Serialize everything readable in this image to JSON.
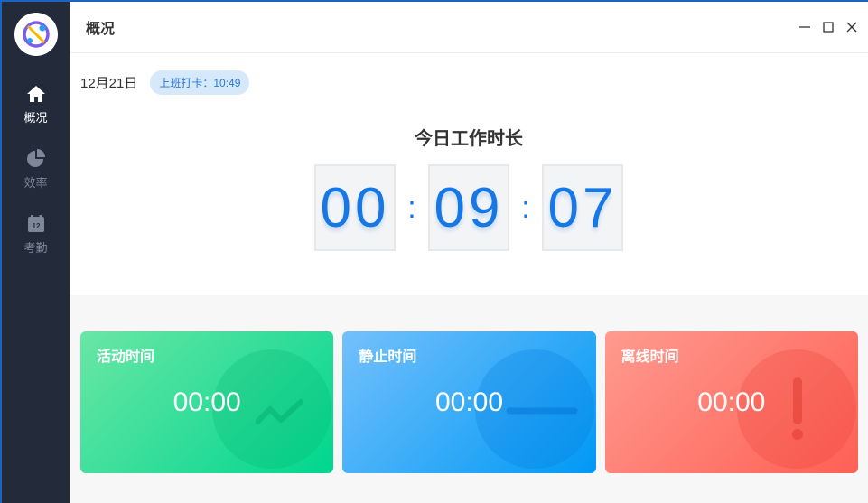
{
  "window": {
    "title": "概况"
  },
  "sidebar": {
    "items": [
      {
        "label": "概况",
        "icon": "home-icon",
        "active": true
      },
      {
        "label": "效率",
        "icon": "pie-chart-icon",
        "active": false
      },
      {
        "label": "考勤",
        "icon": "calendar-icon",
        "active": false
      }
    ]
  },
  "header": {
    "date": "12月21日",
    "checkin_badge": "上班打卡：10:49"
  },
  "work_time": {
    "title": "今日工作时长",
    "hours": "00",
    "minutes": "09",
    "seconds": "07",
    "separator": ":"
  },
  "cards": [
    {
      "title": "活动时间",
      "value": "00:00",
      "icon": "trend-line-icon",
      "color": "#00d68f"
    },
    {
      "title": "静止时间",
      "value": "00:00",
      "icon": "minus-icon",
      "color": "#0099f5"
    },
    {
      "title": "离线时间",
      "value": "00:00",
      "icon": "exclamation-icon",
      "color": "#ff6055"
    }
  ],
  "colors": {
    "sidebar": "#232b3a",
    "accent": "#1677e5",
    "badge_bg": "#d6e9fb"
  }
}
